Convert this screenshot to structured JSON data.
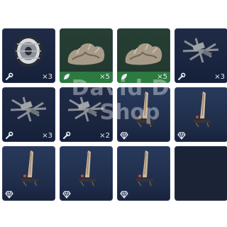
{
  "watermark": {
    "line1": "David D",
    "line2": "Shop"
  },
  "colors": {
    "slot_blue": "#1f2b46",
    "slot_green": "#263e33",
    "green_bar": "#2c7a3f",
    "text": "#e6ebf5"
  },
  "slots": [
    {
      "item": "tire",
      "icon": "wrench-icon",
      "count": "×3"
    },
    {
      "item": "fur-pile",
      "icon": "leaf-icon",
      "count": "×5"
    },
    {
      "item": "fur-pile",
      "icon": "leaf-icon",
      "count": "×5"
    },
    {
      "item": "scrap-parts",
      "icon": "wrench-icon",
      "count": "×3"
    },
    {
      "item": "scrap-parts",
      "icon": "wrench-icon",
      "count": "×3"
    },
    {
      "item": "scrap-parts",
      "icon": "wrench-icon",
      "count": "×2"
    },
    {
      "item": "glider",
      "icon": "diamond-icon",
      "count": ""
    },
    {
      "item": "glider",
      "icon": "diamond-icon",
      "count": ""
    },
    {
      "item": "glider",
      "icon": "diamond-icon",
      "count": ""
    },
    {
      "item": "glider",
      "icon": "diamond-icon",
      "count": ""
    },
    {
      "item": "glider",
      "icon": "diamond-icon",
      "count": ""
    }
  ]
}
